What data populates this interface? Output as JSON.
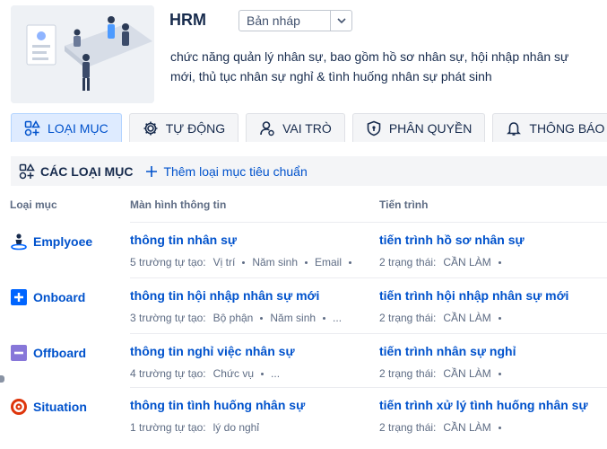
{
  "header": {
    "title": "HRM",
    "status_value": "Bản nháp",
    "description": "chức năng quản lý nhân sự, bao gồm hồ sơ nhân sự, hội nhập nhân sự mới, thủ tục nhân sự nghỉ & tình huống nhân sự phát sinh"
  },
  "tabs": [
    {
      "label": "LOẠI MỤC",
      "icon": "item-types-icon",
      "active": true
    },
    {
      "label": "TỰ ĐỘNG",
      "icon": "gear-icon",
      "active": false
    },
    {
      "label": "VAI TRÒ",
      "icon": "user-icon",
      "active": false
    },
    {
      "label": "PHÂN QUYỀN",
      "icon": "shield-icon",
      "active": false
    },
    {
      "label": "THÔNG BÁO",
      "icon": "bell-icon",
      "active": false
    }
  ],
  "toolbar": {
    "section_title": "CÁC LOẠI MỤC",
    "add_label": "Thêm loại mục tiêu chuẩn"
  },
  "table": {
    "headers": {
      "type": "Loại mục",
      "screen": "Màn hình thông tin",
      "flow": "Tiến trình"
    },
    "rows": [
      {
        "type": "Emplyoee",
        "icon": "employee-icon",
        "screen": "thông tin nhân sự",
        "screen_meta_label": "5 trường tự tạo:",
        "screen_fields": [
          "Vị trí",
          "Năm sinh",
          "Email"
        ],
        "flow": "tiến trình hồ sơ nhân sự",
        "flow_meta_label": "2 trạng thái:",
        "flow_status": "CẦN LÀM"
      },
      {
        "type": "Onboard",
        "icon": "plus-square-icon",
        "screen": "thông tin hội nhập nhân sự mới",
        "screen_meta_label": "3 trường tự tạo:",
        "screen_fields": [
          "Bộ phận",
          "Năm sinh",
          "..."
        ],
        "flow": "tiến trình hội nhập nhân sự mới",
        "flow_meta_label": "2 trạng thái:",
        "flow_status": "CẦN LÀM"
      },
      {
        "type": "Offboard",
        "icon": "minus-square-icon",
        "screen": "thông tin nghỉ việc nhân sự",
        "screen_meta_label": "4 trường tự tạo:",
        "screen_fields": [
          "Chức vụ",
          "..."
        ],
        "flow": "tiến trình nhân sự nghỉ",
        "flow_meta_label": "2 trạng thái:",
        "flow_status": "CẦN LÀM"
      },
      {
        "type": "Situation",
        "icon": "target-icon",
        "screen": "thông tin tình huống nhân sự",
        "screen_meta_label": "1 trường tự tạo:",
        "screen_fields": [
          "lý do nghỉ"
        ],
        "flow": "tiến trình xử lý tình huống nhân sự",
        "flow_meta_label": "2 trạng thái:",
        "flow_status": "CẦN LÀM"
      }
    ]
  },
  "colors": {
    "accent": "#0052cc",
    "tab_active_bg": "#deebff",
    "onboard": "#0065ff",
    "offboard": "#8777d9",
    "situation": "#de350b",
    "employee": "#172b4d"
  }
}
